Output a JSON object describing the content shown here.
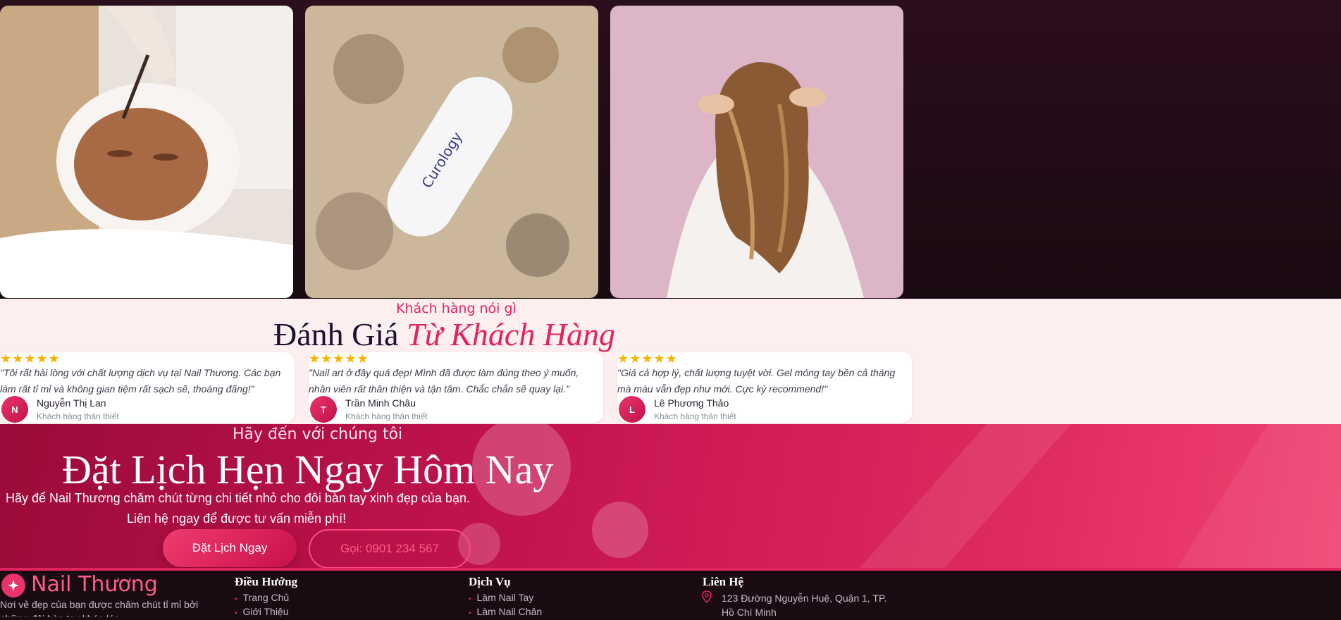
{
  "gallery": {
    "images": [
      {
        "alt": "Facial mask treatment"
      },
      {
        "alt": "Skincare product on sand"
      },
      {
        "alt": "Woman with long wavy hair"
      }
    ],
    "product_brand": "Curology"
  },
  "reviews": {
    "eyebrow": "Khách hàng nói gì",
    "title_plain": "Đánh Giá",
    "title_accent": "Từ Khách Hàng",
    "stars": "★★★★★",
    "items": [
      {
        "quote": "\"Tôi rất hài lòng với chất lượng dịch vụ tại Nail Thương. Các bạn làm rất tỉ mỉ và không gian tiệm rất sạch sẽ, thoáng đãng!\"",
        "initial": "N",
        "name": "Nguyễn Thị Lan",
        "role": "Khách hàng thân thiết"
      },
      {
        "quote": "\"Nail art ở đây quá đẹp! Mình đã được làm đúng theo ý muốn, nhân viên rất thân thiện và tận tâm. Chắc chắn sẽ quay lại.\"",
        "initial": "T",
        "name": "Trần Minh Châu",
        "role": "Khách hàng thân thiết"
      },
      {
        "quote": "\"Giá cả hợp lý, chất lượng tuyệt vời. Gel móng tay bền cả tháng mà màu vẫn đẹp như mới. Cực kỳ recommend!\"",
        "initial": "L",
        "name": "Lê Phương Thảo",
        "role": "Khách hàng thân thiết"
      }
    ]
  },
  "cta": {
    "subtitle": "Hãy đến với chúng tôi",
    "title": "Đặt Lịch Hẹn Ngay Hôm Nay",
    "desc_line1": "Hãy để Nail Thương chăm chút từng chi tiết nhỏ cho đôi bàn tay xinh đẹp của bạn.",
    "desc_line2": "Liên hệ ngay để được tư vấn miễn phí!",
    "primary_label": "Đặt Lịch Ngay",
    "secondary_label": "Gọi: 0901 234 567"
  },
  "footer": {
    "brand": "Nail Thương",
    "tagline": "Nơi vẻ đẹp của bạn được chăm chút tỉ mỉ bởi những đôi bàn tay khéo léo",
    "nav_heading": "Điều Hướng",
    "nav_links": [
      "Trang Chủ",
      "Giới Thiệu"
    ],
    "services_heading": "Dịch Vụ",
    "services_links": [
      "Làm Nail Tay",
      "Làm Nail Chân"
    ],
    "contact_heading": "Liên Hệ",
    "address": "123 Đường Nguyễn Huệ, Quận 1, TP. Hồ Chí Minh"
  },
  "colors": {
    "accent": "#e0245e",
    "star": "#f5b400",
    "dark_bg": "#1a0b12",
    "reviews_bg": "#fdeef0"
  }
}
